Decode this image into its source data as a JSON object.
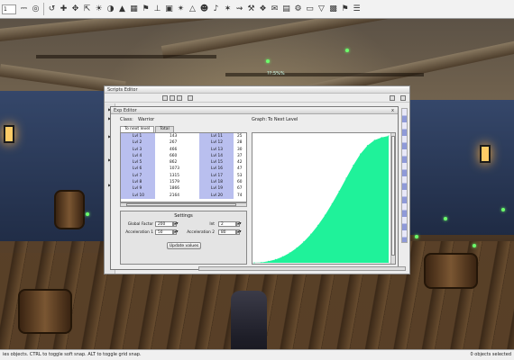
{
  "toolbar": {
    "dropdown_value": "1",
    "icons": [
      "select-icon",
      "lock-icon",
      "eye-icon",
      "undo-icon",
      "cross-icon",
      "move-icon",
      "scale-icon",
      "light-icon",
      "globe-icon",
      "terrain-icon",
      "grid-icon",
      "flag-icon",
      "axis-icon",
      "camera-icon",
      "star-icon",
      "mountain-icon",
      "ai-icon",
      "sound-icon",
      "fx-icon",
      "path-icon",
      "hammer-icon",
      "transform-icon",
      "speech-icon",
      "table-icon",
      "tool-icon",
      "folder-icon",
      "filter-icon",
      "cube-icon",
      "bookmark-icon",
      "settings-icon"
    ]
  },
  "scene": {
    "marker_label": "??:5%%"
  },
  "back_window": {
    "title": "Scripts Editor"
  },
  "exp_editor": {
    "title": "Exp Editor",
    "close_glyph": "x",
    "class_label": "Class:",
    "class_value": "Warrior",
    "graph_label": "Graph:",
    "graph_value": "To Next Level",
    "tabs": [
      "To next level",
      "Total"
    ],
    "levels_left": [
      "Lvl 1",
      "Lvl 2",
      "Lvl 3",
      "Lvl 4",
      "Lvl 5",
      "Lvl 6",
      "Lvl 7",
      "Lvl 8",
      "Lvl 9",
      "Lvl 10"
    ],
    "values_left": [
      "143",
      "267",
      "466",
      "660",
      "862",
      "1073",
      "1315",
      "1579",
      "1866",
      "2164"
    ],
    "levels_right": [
      "Lvl 11",
      "Lvl 12",
      "Lvl 13",
      "Lvl 14",
      "Lvl 15",
      "Lvl 16",
      "Lvl 17",
      "Lvl 18",
      "Lvl 19",
      "Lvl 20"
    ],
    "values_right": [
      "25",
      "28",
      "30",
      "37",
      "42",
      "47",
      "53",
      "60",
      "67",
      "74"
    ],
    "settings": {
      "header": "Settings",
      "global_factor_label": "Global Factor",
      "global_factor_value": "200",
      "int_label": "Int",
      "int_value": "2",
      "accel1_label": "Acceleration 1",
      "accel1_value": "50",
      "accel2_label": "Acceleration 2",
      "accel2_value": "80",
      "update_button": "Update values"
    }
  },
  "chart_data": {
    "type": "area",
    "title": "",
    "xlabel": "",
    "ylabel": "",
    "fill_color": "#1ff29a",
    "x": [
      1,
      2,
      3,
      4,
      5,
      6,
      7,
      8,
      9,
      10,
      11,
      12,
      13,
      14,
      15,
      16,
      17,
      18,
      19,
      20
    ],
    "values": [
      0.0,
      0.3,
      1.2,
      2.6,
      4.8,
      7.8,
      11.7,
      16.6,
      22.5,
      29.5,
      37.5,
      46.6,
      56.4,
      66.7,
      76.8,
      85.7,
      92.4,
      96.6,
      98.8,
      100.0
    ]
  },
  "statusbar": {
    "left_text": "ies objects.  CTRL to toggle soft snap.  ALT to toggle grid snap.",
    "right_text": "0 objects selected"
  }
}
